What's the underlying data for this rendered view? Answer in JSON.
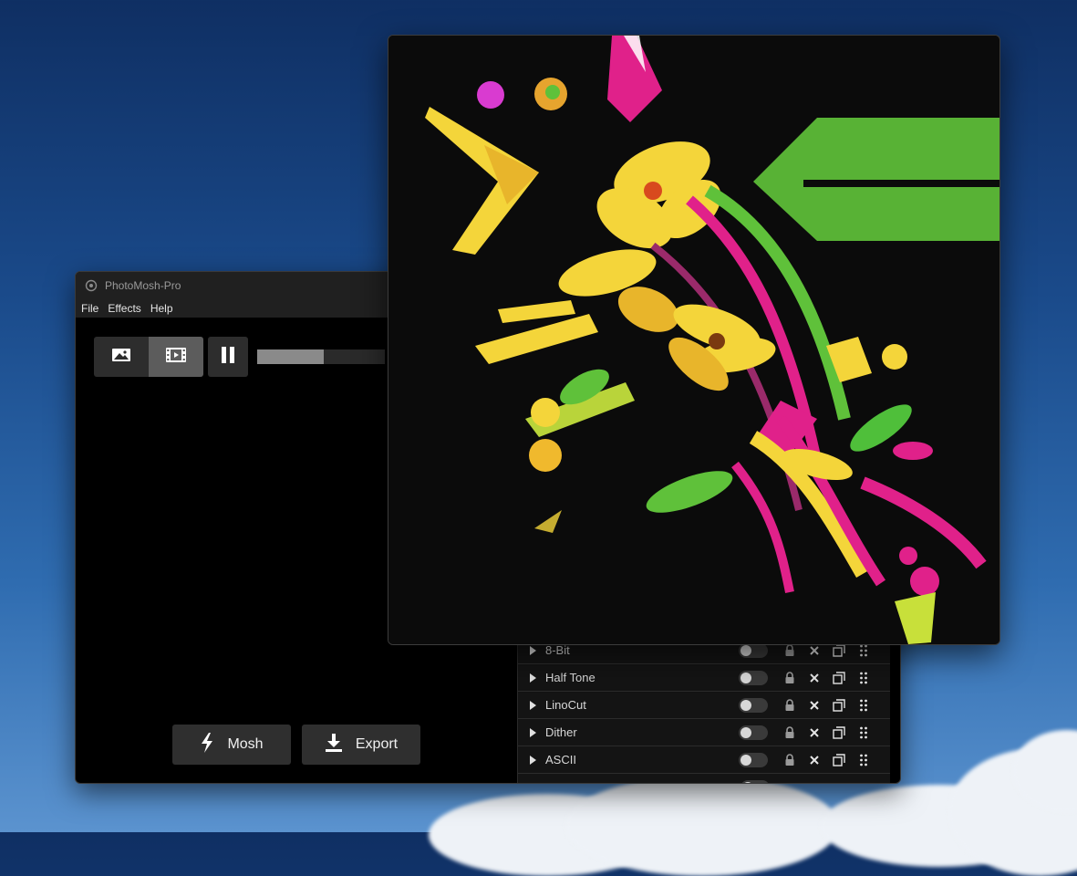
{
  "app": {
    "title": "PhotoMosh-Pro",
    "menu": [
      "File",
      "Effects",
      "Help"
    ]
  },
  "toolbar": {
    "modes": [
      {
        "name": "image-mode",
        "icon": "image-icon",
        "active": false
      },
      {
        "name": "video-mode",
        "icon": "film-icon",
        "active": true
      }
    ],
    "pause_icon": "pause-icon",
    "progress_fraction": 0.52
  },
  "actions": {
    "mosh_label": "Mosh",
    "mosh_icon": "lightning-icon",
    "export_label": "Export",
    "export_icon": "download-icon"
  },
  "effects": [
    {
      "name": "8-Bit",
      "enabled": false
    },
    {
      "name": "Half Tone",
      "enabled": false
    },
    {
      "name": "LinoCut",
      "enabled": false
    },
    {
      "name": "Dither",
      "enabled": false
    },
    {
      "name": "ASCII",
      "enabled": false
    }
  ],
  "row_icons": [
    "lock-icon",
    "close-icon",
    "duplicate-icon",
    "drag-handle-icon"
  ],
  "colors": {
    "window_bg": "#000000",
    "titlebar_bg": "#202020",
    "button_bg": "#2f2f2f",
    "active_mode_bg": "#5c5c5c",
    "art_yellow": "#f4d53a",
    "art_magenta": "#e0218a",
    "art_green": "#5fc13a"
  }
}
